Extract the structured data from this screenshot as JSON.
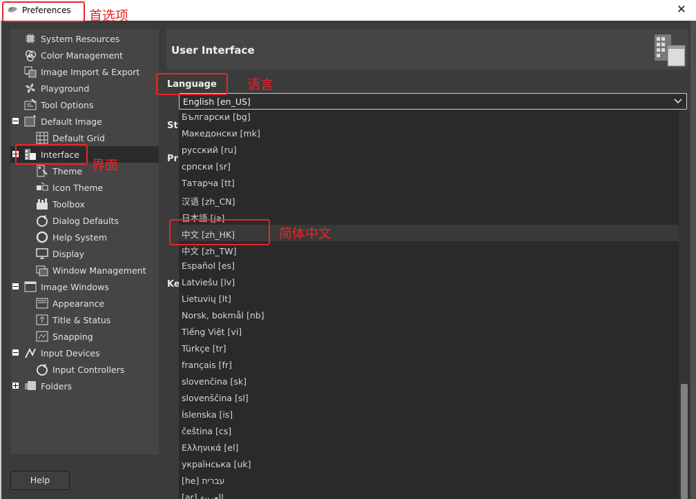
{
  "window": {
    "title": "Preferences",
    "close_glyph": "✕"
  },
  "annotations": {
    "preferences": "首选项",
    "language": "语言",
    "interface": "界面",
    "zh_hk": "简体中文"
  },
  "sidebar": {
    "items": [
      {
        "id": "system-resources",
        "label": "System Resources",
        "icon": "chip-icon",
        "depth": 0,
        "expander": ""
      },
      {
        "id": "color-management",
        "label": "Color Management",
        "icon": "color-circles-icon",
        "depth": 0,
        "expander": ""
      },
      {
        "id": "image-import-export",
        "label": "Image Import & Export",
        "icon": "import-export-icon",
        "depth": 0,
        "expander": ""
      },
      {
        "id": "playground",
        "label": "Playground",
        "icon": "fan-icon",
        "depth": 0,
        "expander": ""
      },
      {
        "id": "tool-options",
        "label": "Tool Options",
        "icon": "tool-options-icon",
        "depth": 0,
        "expander": ""
      },
      {
        "id": "default-image",
        "label": "Default Image",
        "icon": "default-image-icon",
        "depth": 0,
        "expander": "minus"
      },
      {
        "id": "default-grid",
        "label": "Default Grid",
        "icon": "grid-icon",
        "depth": 1,
        "expander": ""
      },
      {
        "id": "interface",
        "label": "Interface",
        "icon": "interface-icon",
        "depth": 0,
        "expander": "minus",
        "selected": true
      },
      {
        "id": "theme",
        "label": "Theme",
        "icon": "theme-icon",
        "depth": 1,
        "expander": ""
      },
      {
        "id": "icon-theme",
        "label": "Icon Theme",
        "icon": "icon-theme-icon",
        "depth": 1,
        "expander": ""
      },
      {
        "id": "toolbox",
        "label": "Toolbox",
        "icon": "toolbox-icon",
        "depth": 1,
        "expander": ""
      },
      {
        "id": "dialog-defaults",
        "label": "Dialog Defaults",
        "icon": "dialog-defaults-icon",
        "depth": 1,
        "expander": ""
      },
      {
        "id": "help-system",
        "label": "Help System",
        "icon": "help-lifebuoy-icon",
        "depth": 1,
        "expander": ""
      },
      {
        "id": "display",
        "label": "Display",
        "icon": "display-icon",
        "depth": 1,
        "expander": ""
      },
      {
        "id": "window-management",
        "label": "Window Management",
        "icon": "window-management-icon",
        "depth": 1,
        "expander": ""
      },
      {
        "id": "image-windows",
        "label": "Image Windows",
        "icon": "image-window-icon",
        "depth": 0,
        "expander": "minus"
      },
      {
        "id": "appearance",
        "label": "Appearance",
        "icon": "appearance-icon",
        "depth": 1,
        "expander": ""
      },
      {
        "id": "title-status",
        "label": "Title & Status",
        "icon": "title-status-icon",
        "depth": 1,
        "expander": ""
      },
      {
        "id": "snapping",
        "label": "Snapping",
        "icon": "snapping-icon",
        "depth": 1,
        "expander": ""
      },
      {
        "id": "input-devices",
        "label": "Input Devices",
        "icon": "input-devices-icon",
        "depth": 0,
        "expander": "minus"
      },
      {
        "id": "input-controllers",
        "label": "Input Controllers",
        "icon": "input-controllers-icon",
        "depth": 1,
        "expander": ""
      },
      {
        "id": "folders",
        "label": "Folders",
        "icon": "folders-icon",
        "depth": 0,
        "expander": "plus"
      }
    ]
  },
  "help_button": {
    "label": "Help"
  },
  "main": {
    "header_title": "User Interface",
    "header_icon": "interface-large-icon",
    "language_section_label": "Language",
    "peek_labels": [
      "St",
      "Pr",
      "Ke"
    ],
    "language_combo": {
      "value": "English [en_US]",
      "icon": "chevron-down-icon"
    },
    "language_options": [
      "Български [bg]",
      "Македонски [mk]",
      "русский [ru]",
      "српски [sr]",
      "Татарча [tt]",
      "汉语 [zh_CN]",
      "日本語 [ja]",
      "中文 [zh_HK]",
      "中文 [zh_TW]",
      "Español [es]",
      "Latviešu [lv]",
      "Lietuvių [lt]",
      "Norsk, bokmål [nb]",
      "Tiếng Việt [vi]",
      "Türkçe [tr]",
      "français [fr]",
      "slovenčina [sk]",
      "slovenščina [sl]",
      "Íslenska [is]",
      "čeština [cs]",
      "Ελληνικά [el]",
      "українська [uk]",
      "[he] עברית",
      "[ar] العربية"
    ],
    "highlighted_option_index": 7
  }
}
